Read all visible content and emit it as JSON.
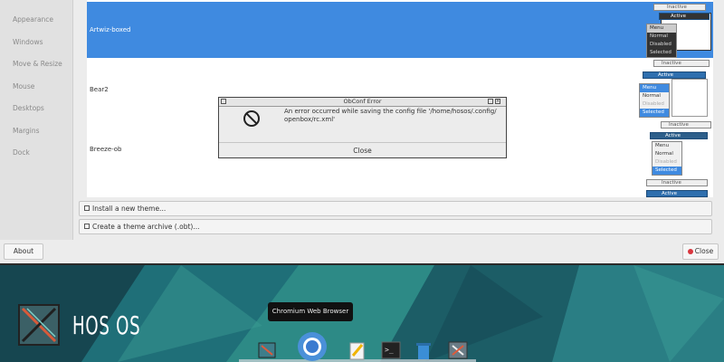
{
  "sidebar": {
    "items": [
      "Appearance",
      "Windows",
      "Move & Resize",
      "Mouse",
      "Desktops",
      "Margins",
      "Dock"
    ]
  },
  "themes": [
    {
      "name": "Artwiz-boxed",
      "selected": true
    },
    {
      "name": "Bear2",
      "selected": false
    },
    {
      "name": "Breeze-ob",
      "selected": false
    }
  ],
  "preview": {
    "active": "Active",
    "inactive": "Inactive",
    "menu": "Menu",
    "normal": "Normal",
    "disabled": "Disabled",
    "selected": "Selected"
  },
  "buttons": {
    "install": "Install a new theme...",
    "archive": "Create a theme archive (.obt)...",
    "about": "About",
    "close": "Close"
  },
  "dialog": {
    "title": "ObConf Error",
    "message_line1": "An error occurred while saving the config file '/home/hosos/.config/",
    "message_line2": "openbox/rc.xml'",
    "close": "Close"
  },
  "desktop": {
    "brand": "HOS OS",
    "tooltip": "Chromium Web Browser",
    "dock_icons": [
      "obconf-icon",
      "chromium-icon",
      "text-editor-icon",
      "terminal-icon",
      "trash-icon",
      "settings-icon"
    ]
  },
  "colors": {
    "selection": "#3f8ae0",
    "close_icon": "#d9363e"
  }
}
